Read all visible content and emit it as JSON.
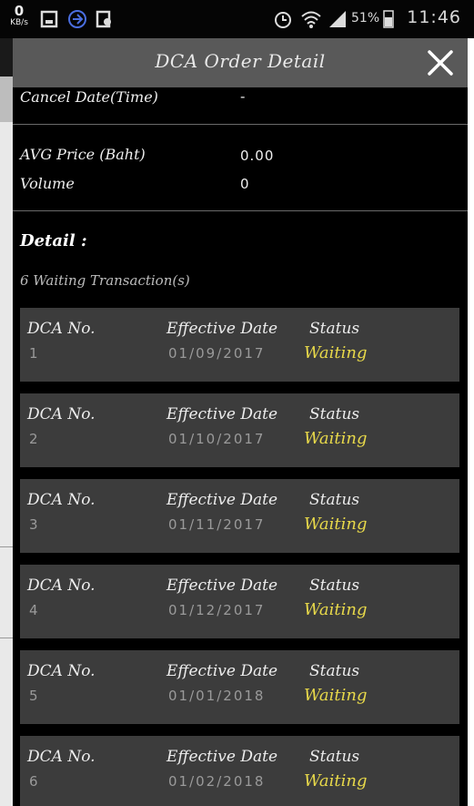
{
  "status_bar": {
    "speed_value": "0",
    "speed_unit": "KB/s",
    "battery_percent": "51%",
    "time": "11:46",
    "icons": [
      "download-icon",
      "vpn-icon",
      "app-icon",
      "alarm-icon",
      "wifi-icon",
      "signal-icon",
      "battery-icon"
    ]
  },
  "dialog": {
    "title": "DCA Order Detail",
    "close_icon": "close-icon"
  },
  "summary": {
    "cancel_date_label": "Cancel Date(Time)",
    "cancel_date_value": "-",
    "avg_price_label": "AVG Price (Baht)",
    "avg_price_value": "0.00",
    "volume_label": "Volume",
    "volume_value": "0"
  },
  "detail": {
    "heading": "Detail :",
    "waiting_count": "6 Waiting Transaction(s)",
    "col_dca": "DCA No.",
    "col_date": "Effective Date",
    "col_status": "Status",
    "items": [
      {
        "dca_no": "1",
        "date": "01/09/2017",
        "status": "Waiting"
      },
      {
        "dca_no": "2",
        "date": "01/10/2017",
        "status": "Waiting"
      },
      {
        "dca_no": "3",
        "date": "01/11/2017",
        "status": "Waiting"
      },
      {
        "dca_no": "4",
        "date": "01/12/2017",
        "status": "Waiting"
      },
      {
        "dca_no": "5",
        "date": "01/01/2018",
        "status": "Waiting"
      },
      {
        "dca_no": "6",
        "date": "01/02/2018",
        "status": "Waiting"
      }
    ]
  },
  "colors": {
    "status_waiting": "#e8d94a",
    "card_bg": "#3c3c3c",
    "titlebar_bg": "#595959"
  }
}
